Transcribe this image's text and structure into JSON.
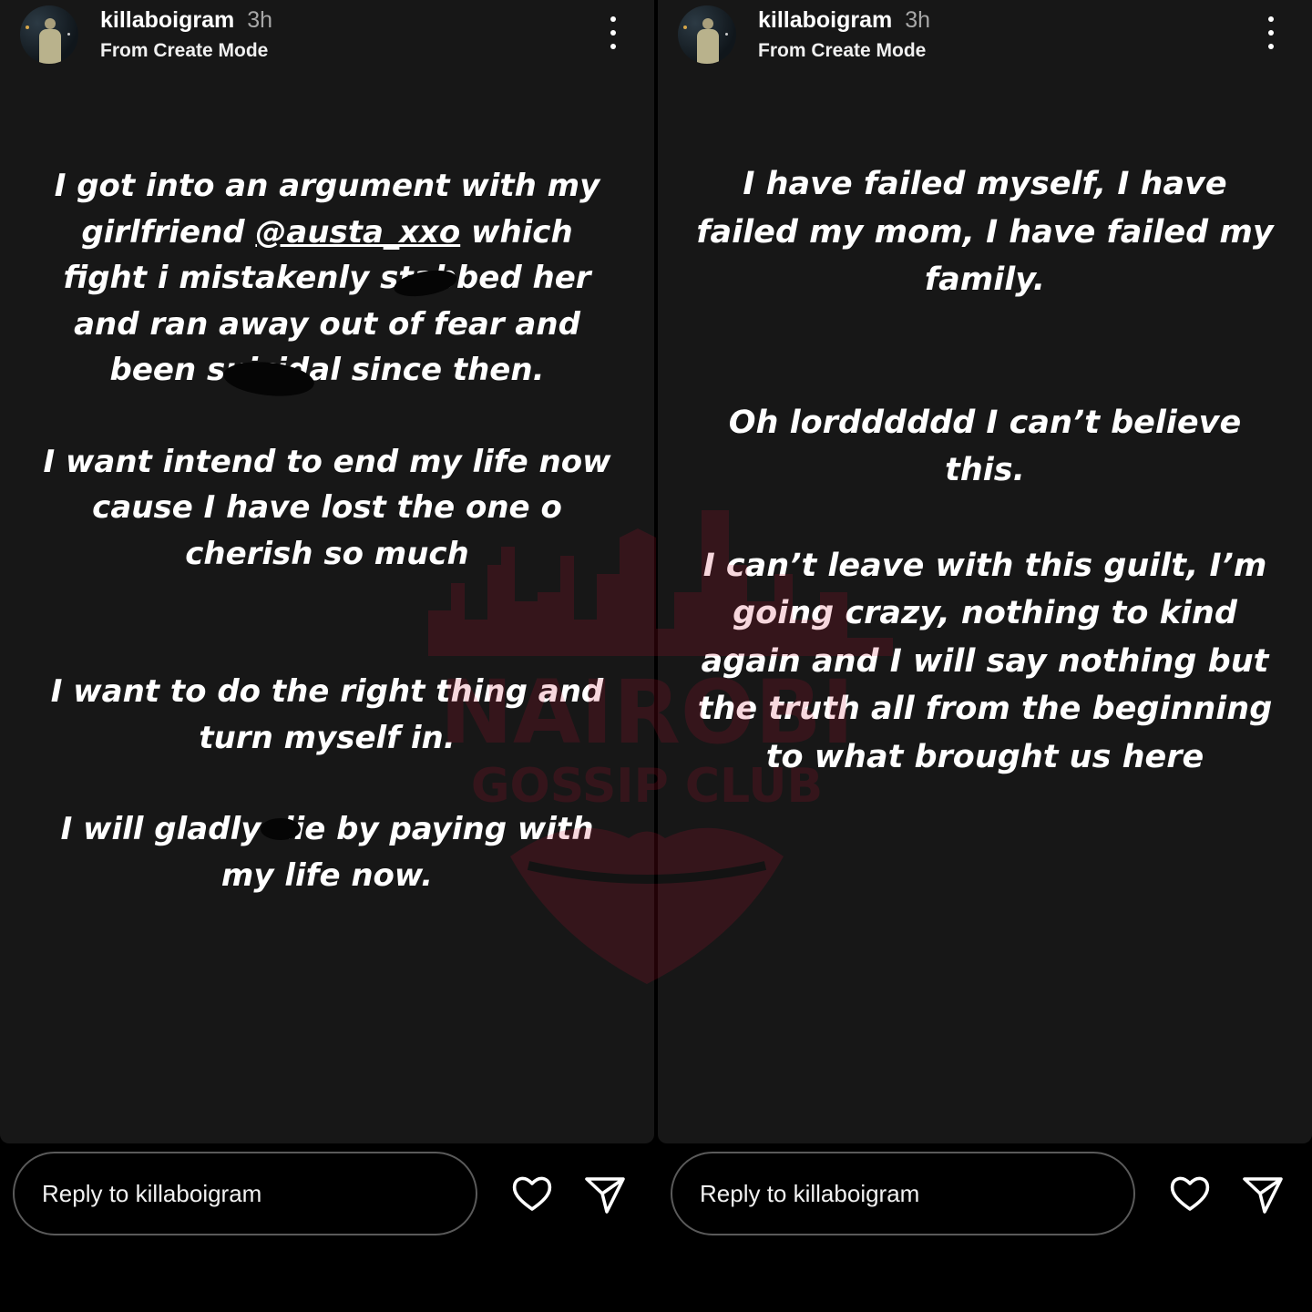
{
  "stories": [
    {
      "username": "killaboigram",
      "time": "3h",
      "subtitle": "From Create Mode",
      "paragraphs": [
        {
          "before": "I got into an argument with my girlfriend ",
          "mention": "@austa_xxo",
          "after": " which fight i mistakenly stabbed her and ran away out of fear and been suicidal since then."
        },
        {
          "text": "I want intend to end my life now cause I have lost the one o cherish so much"
        },
        {
          "text": "I want to do the right thing and turn myself in."
        },
        {
          "text": "I will gladly die by paying with my life now."
        }
      ],
      "reply_placeholder": "Reply to killaboigram"
    },
    {
      "username": "killaboigram",
      "time": "3h",
      "subtitle": "From Create Mode",
      "paragraphs": [
        {
          "text": "I have failed myself, I have failed my mom, I have failed my family."
        },
        {
          "text": "Oh lordddddd I can’t believe this."
        },
        {
          "text": "I can’t leave with this guilt, I’m going crazy, nothing to kind again and I will say nothing but the truth all from the beginning to what brought us here"
        }
      ],
      "reply_placeholder": "Reply to killaboigram"
    }
  ],
  "watermark": {
    "line1": "NAIROBI",
    "line2": "GOSSIP CLUB",
    "color": "#d01030"
  },
  "icons": {
    "avatar": "profile-photo",
    "more": "more-vertical-icon",
    "like": "heart-icon",
    "share": "send-icon"
  }
}
